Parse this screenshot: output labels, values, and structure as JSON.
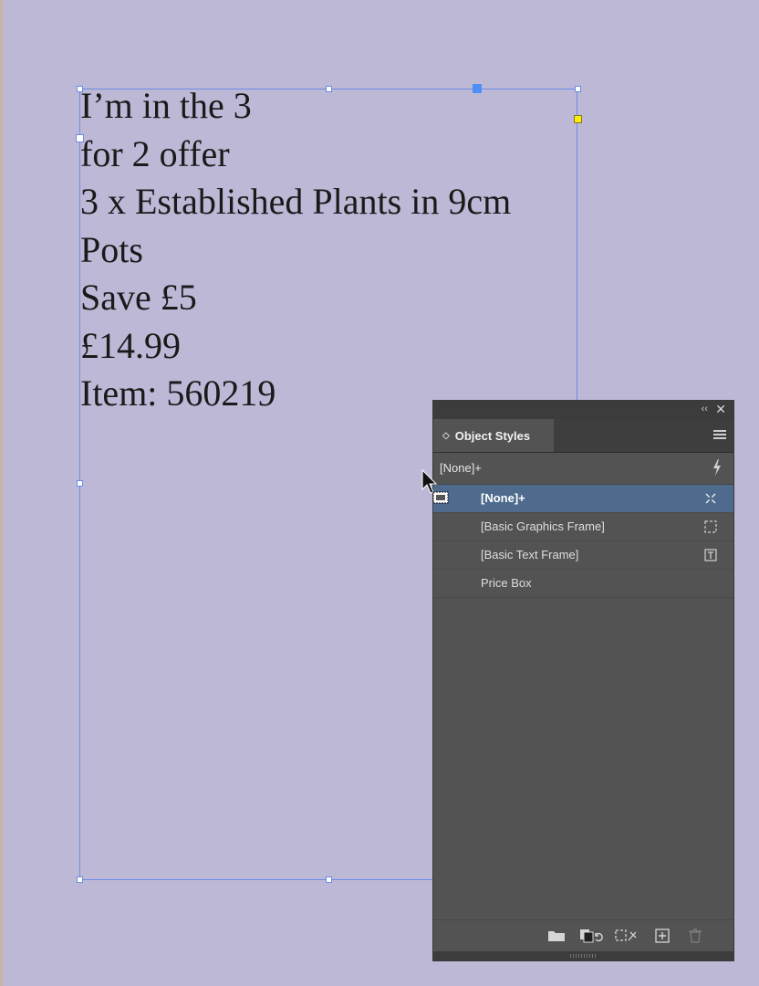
{
  "document": {
    "story_lines": [
      "I’m in the 3",
      "for 2 offer",
      "3 x Established Plants in 9cm",
      "Pots",
      "Save £5",
      "£14.99",
      "Item: 560219"
    ]
  },
  "panel": {
    "collapse_glyph": "‹‹",
    "close_glyph": "✕",
    "tab_arrows": "◇",
    "title": "Object Styles",
    "current_style": "[None]+",
    "styles": [
      {
        "label": "[None]+",
        "icon": "none-style-icon",
        "selected": true
      },
      {
        "label": "[Basic Graphics Frame]",
        "icon": "graphics-frame-icon",
        "selected": false
      },
      {
        "label": "[Basic Text Frame]",
        "icon": "text-frame-icon",
        "selected": false
      },
      {
        "label": "Price Box",
        "icon": "",
        "selected": false
      }
    ],
    "bottom_buttons": [
      "new-group-icon",
      "clear-overrides-icon",
      "clear-attributes-icon",
      "new-style-icon",
      "delete-style-icon"
    ]
  },
  "colors": {
    "canvas": "#bdb8d6",
    "frame": "#6b8ce6",
    "panel_bg": "#535353",
    "selection": "#4e6b8d"
  }
}
